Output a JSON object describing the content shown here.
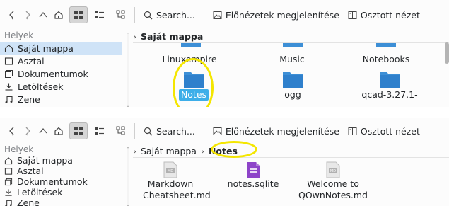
{
  "top": {
    "toolbar": {
      "search_label": "Search...",
      "preview_label": "Előnézetek megjelenítése",
      "split_label": "Osztott nézet"
    },
    "sidebar": {
      "heading": "Helyek",
      "items": [
        {
          "label": "Saját mappa",
          "icon": "home-icon",
          "selected": true
        },
        {
          "label": "Asztal",
          "icon": "desktop-icon"
        },
        {
          "label": "Dokumentumok",
          "icon": "documents-icon"
        },
        {
          "label": "Letöltések",
          "icon": "downloads-icon"
        },
        {
          "label": "Zene",
          "icon": "music-icon"
        }
      ]
    },
    "breadcrumb": [
      "Saját mappa"
    ],
    "files": [
      {
        "label": "Linuxempire"
      },
      {
        "label": "Music"
      },
      {
        "label": "Notebooks"
      },
      {
        "label": "Notes",
        "selected": true
      },
      {
        "label": "ogg"
      },
      {
        "label": "qcad-3.27.1-"
      }
    ]
  },
  "bottom": {
    "toolbar": {
      "search_label": "Search...",
      "preview_label": "Előnézetek megjelenítése",
      "split_label": "Osztott nézet"
    },
    "sidebar": {
      "heading": "Helyek",
      "items": [
        {
          "label": "Saját mappa",
          "icon": "home-icon"
        },
        {
          "label": "Asztal",
          "icon": "desktop-icon"
        },
        {
          "label": "Dokumentumok",
          "icon": "documents-icon"
        },
        {
          "label": "Letöltések",
          "icon": "downloads-icon"
        },
        {
          "label": "Zene",
          "icon": "music-icon"
        }
      ]
    },
    "breadcrumb": [
      "Saját mappa",
      "Notes"
    ],
    "files": [
      {
        "label_line1": "Markdown",
        "label_line2": "Cheatsheet.md",
        "icon": "markdown-file-icon"
      },
      {
        "label_line1": "notes.sqlite",
        "label_line2": "",
        "icon": "sqlite-file-icon"
      },
      {
        "label_line1": "Welcome to",
        "label_line2": "QOwnNotes.md",
        "icon": "markdown-file-icon"
      }
    ]
  },
  "colors": {
    "highlight": "#f4e600",
    "folder": "#3d8fd6",
    "selection": "#3daee9",
    "sidebar_selected": "#cfe3f7",
    "sqlite_icon": "#8e44c9"
  }
}
